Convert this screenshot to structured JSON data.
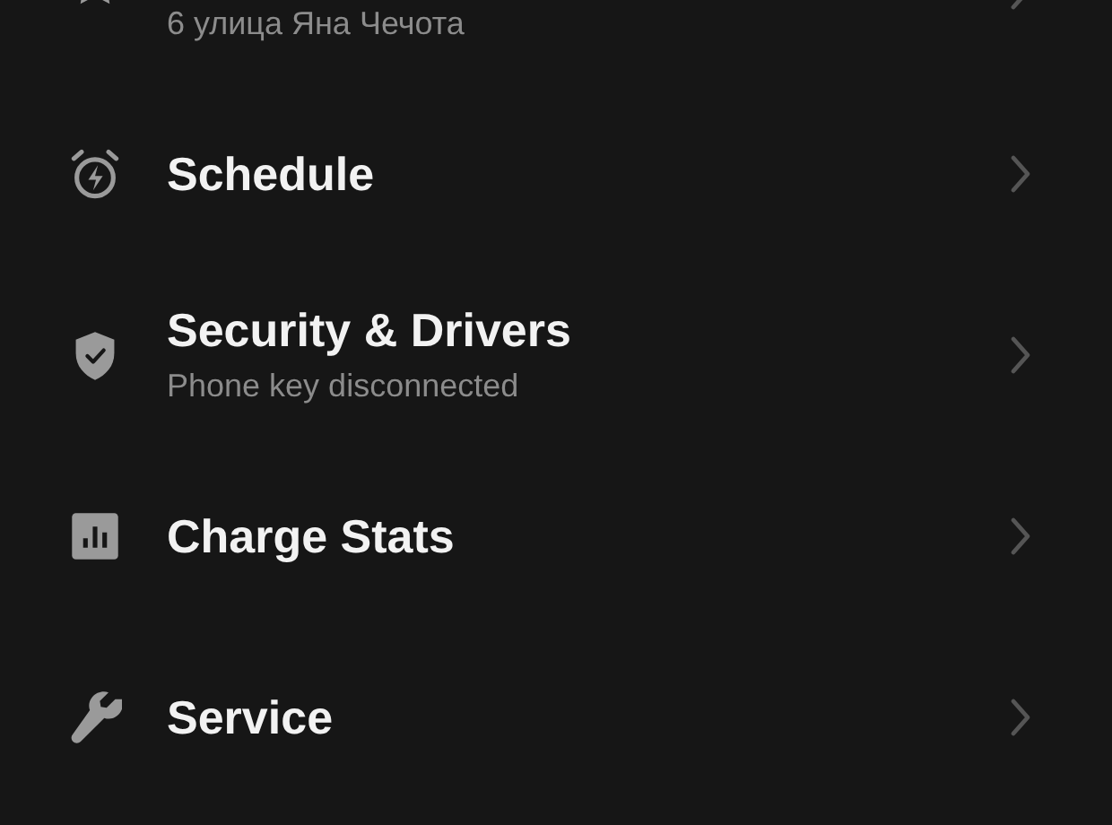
{
  "menu": [
    {
      "subtitle": "6 улица Яна Чечота"
    },
    {
      "title": "Schedule"
    },
    {
      "title": "Security & Drivers",
      "subtitle": "Phone key disconnected"
    },
    {
      "title": "Charge Stats"
    },
    {
      "title": "Service"
    }
  ]
}
